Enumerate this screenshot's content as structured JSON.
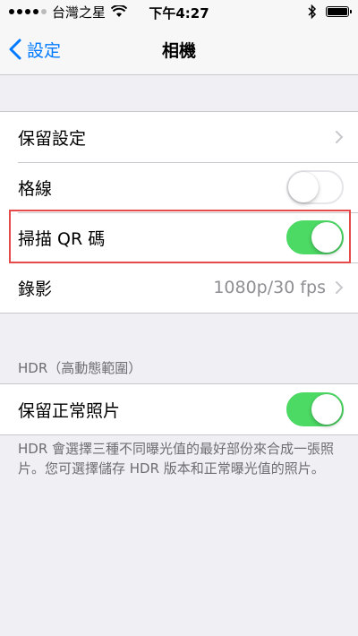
{
  "status_bar": {
    "carrier": "台灣之星",
    "time": "下午4:27"
  },
  "nav": {
    "back_label": "設定",
    "title": "相機"
  },
  "group1": {
    "rows": [
      {
        "label": "保留設定",
        "type": "chevron"
      },
      {
        "label": "格線",
        "type": "toggle",
        "on": false
      },
      {
        "label": "掃描 QR 碼",
        "type": "toggle",
        "on": true
      },
      {
        "label": "錄影",
        "type": "chevron",
        "value": "1080p/30 fps"
      }
    ]
  },
  "hdr_section": {
    "header": "HDR（高動態範圍）",
    "rows": [
      {
        "label": "保留正常照片",
        "type": "toggle",
        "on": true
      }
    ],
    "footer": "HDR 會選擇三種不同曝光值的最好部份來合成一張照片。您可選擇儲存 HDR 版本和正常曝光值的照片。"
  },
  "colors": {
    "accent": "#007aff",
    "toggle_on": "#4cd964",
    "highlight": "#e64b4b"
  }
}
